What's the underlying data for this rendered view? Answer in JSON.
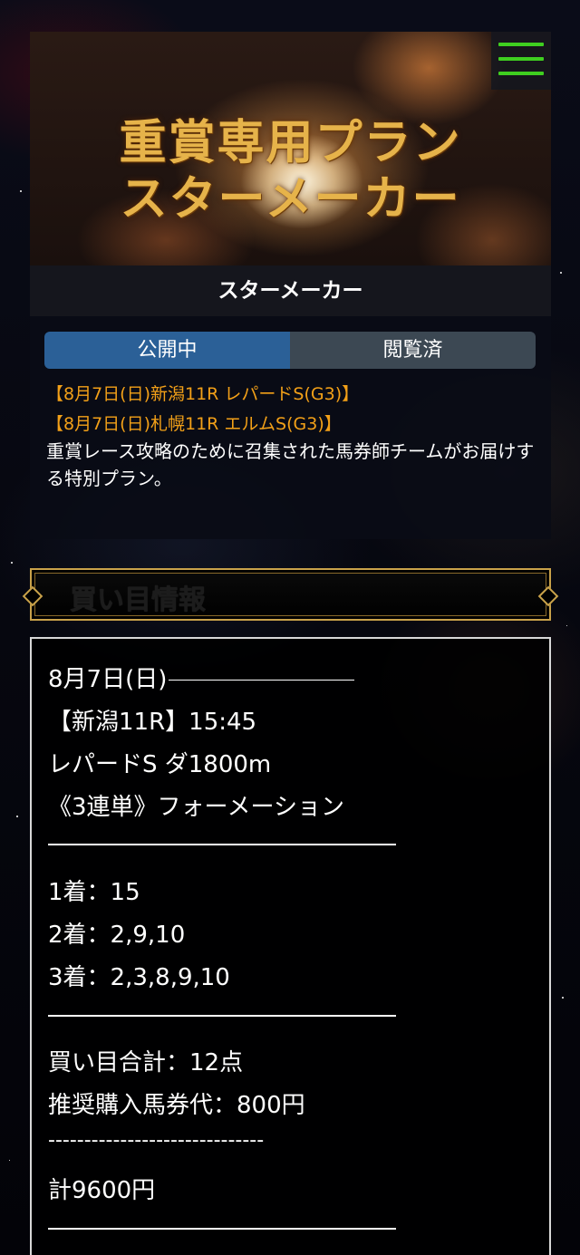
{
  "banner": {
    "line1": "重賞専用プラン",
    "line2": "スターメーカー"
  },
  "menu": {
    "icon": "hamburger-menu-icon",
    "color": "#3fcf20"
  },
  "plan": {
    "title": "スターメーカー",
    "tabs": [
      {
        "label": "公開中",
        "active": true
      },
      {
        "label": "閲覧済",
        "active": false
      }
    ],
    "races": [
      "【8月7日(日)新潟11R レパードS(G3)】",
      "【8月7日(日)札幌11R エルムS(G3)】"
    ],
    "description": "重賞レース攻略のために召集された馬券師チームがお届けする特別プラン。"
  },
  "section": {
    "title": "買い目情報"
  },
  "info": {
    "date": "8月7日(日)",
    "race": "【新潟11R】15:45",
    "course": "レパードS ダ1800m",
    "bet_type": "《3連単》フォーメーション",
    "first": "1着：15",
    "second": "2着：2,9,10",
    "third": "3着：2,3,8,9,10",
    "total_points": "買い目合計：12点",
    "recommended": "推奨購入馬券代：800円",
    "dash_line": "------------------------------",
    "grand_total": "計9600円"
  },
  "colors": {
    "accent_link": "#f2a018",
    "tab_active": "#2b6097",
    "tab_inactive": "#3c4853",
    "gold_frame": "#c9a24a"
  }
}
